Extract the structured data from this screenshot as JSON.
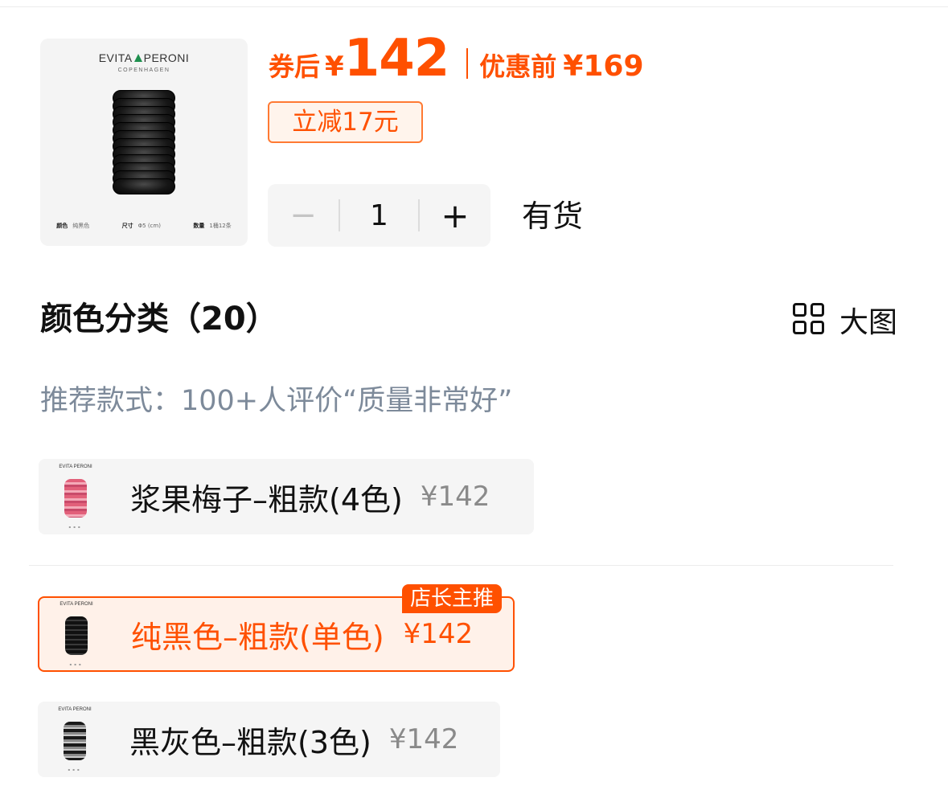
{
  "product": {
    "brand": "EVITA PERONI",
    "brand_sub": "COPENHAGEN",
    "specs": [
      {
        "key": "颜色",
        "value": "纯黑色"
      },
      {
        "key": "尺寸",
        "value": "Φ5 (cm)"
      },
      {
        "key": "数量",
        "value": "1桶12条"
      }
    ]
  },
  "price": {
    "coupon_label": "券后",
    "currency": "¥",
    "coupon_price": "142",
    "original_label": "优惠前",
    "original_price": "¥169",
    "discount_tag": "立减17元"
  },
  "quantity": {
    "minus": "−",
    "value": "1",
    "plus": "+"
  },
  "stock_status": "有货",
  "section": {
    "title": "颜色分类（20）",
    "big_view_label": "大图",
    "recommendation": "推荐款式：100+人评价“质量非常好”"
  },
  "options": [
    {
      "label": "浆果梅子–粗款(4色)",
      "price": "¥142",
      "selected": false,
      "thumb_brand": "EVITA PERONI"
    },
    {
      "label": "纯黑色–粗款(单色)",
      "price": "¥142",
      "selected": true,
      "badge": "店长主推",
      "thumb_brand": "EVITA PERONI"
    },
    {
      "label": "黑灰色–粗款(3色)",
      "price": "¥142",
      "selected": false,
      "thumb_brand": "EVITA PERONI"
    }
  ],
  "colors": {
    "accent": "#ff5000",
    "muted_text": "#7d8a9a",
    "chip_bg": "#f5f5f5"
  },
  "icons": {
    "grid": "grid-view-icon",
    "minus": "minus-icon",
    "plus": "plus-icon"
  }
}
